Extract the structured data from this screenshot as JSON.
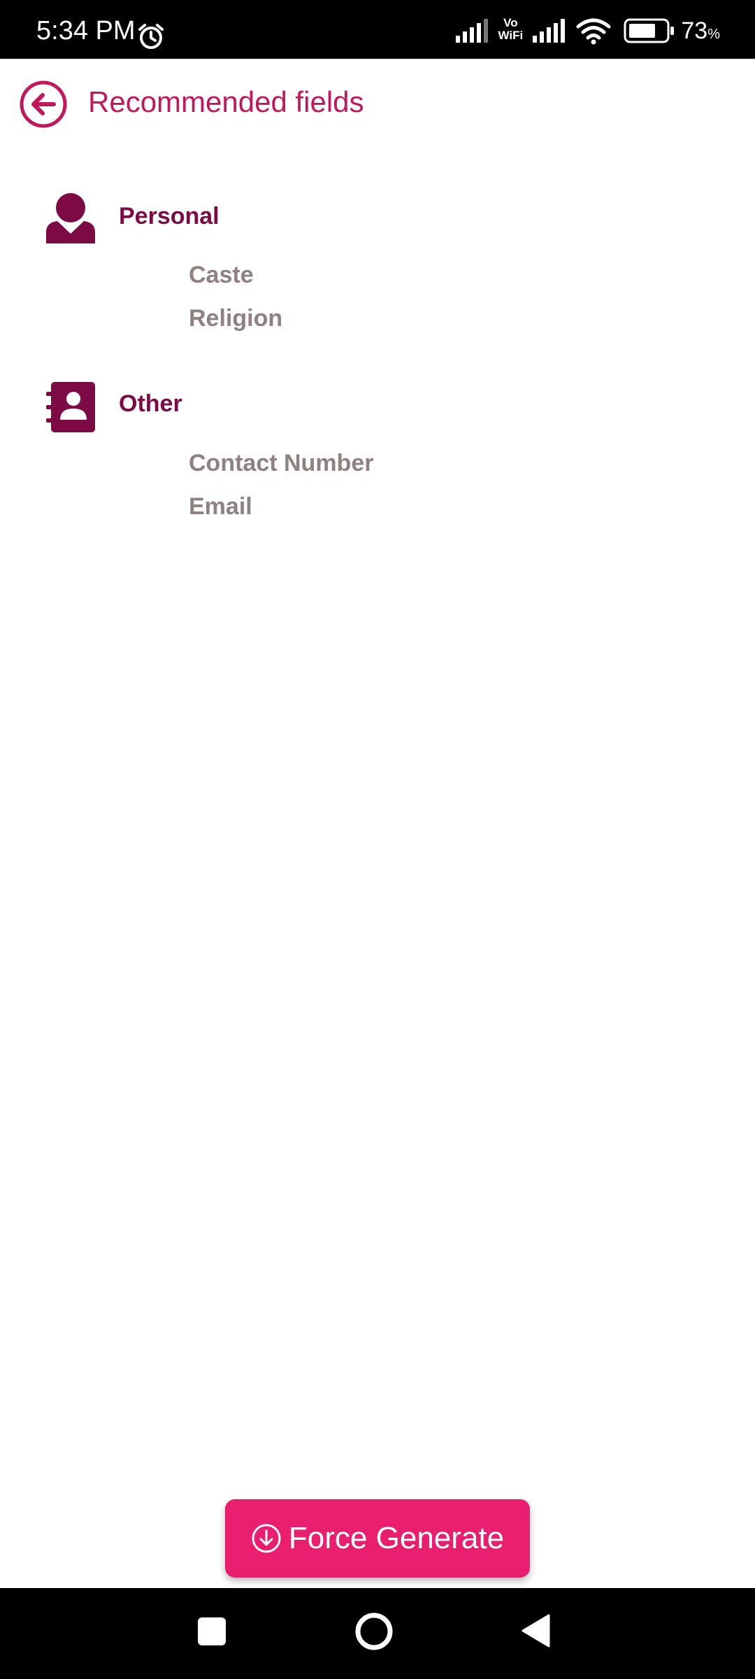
{
  "status_bar": {
    "time": "5:34 PM",
    "vo_label": "Vo",
    "wifi_label": "WiFi",
    "battery_value": "73",
    "battery_unit": "%",
    "icons": [
      "alarm-icon",
      "signal-icon",
      "vowifi-icon",
      "wifi-icon",
      "battery-icon"
    ]
  },
  "header": {
    "title": "Recommended fields",
    "back_icon": "arrow-left-circle-icon"
  },
  "sections": [
    {
      "title": "Personal",
      "icon": "person-icon",
      "fields": [
        "Caste",
        "Religion"
      ]
    },
    {
      "title": "Other",
      "icon": "contact-book-icon",
      "fields": [
        "Contact Number",
        "Email"
      ]
    }
  ],
  "action_button": {
    "label": "Force Generate",
    "icon": "download-circle-icon"
  },
  "colors": {
    "accent": "#c2185b",
    "section_title": "#7b0a45",
    "field_text": "#8d8280",
    "button": "#e91e6f"
  }
}
